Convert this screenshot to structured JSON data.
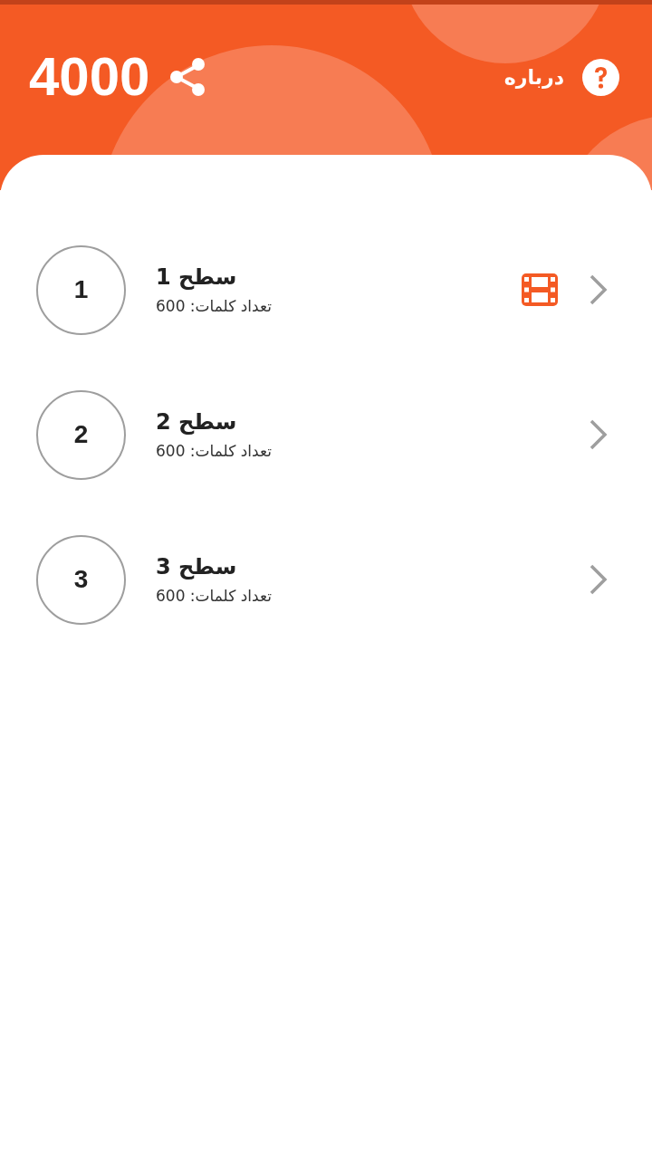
{
  "header": {
    "score": "4000",
    "about": "درباره"
  },
  "levels": [
    {
      "number": "1",
      "title": "سطح 1",
      "subtitle": "تعداد کلمات: 600",
      "video": true
    },
    {
      "number": "2",
      "title": "سطح 2",
      "subtitle": "تعداد کلمات: 600",
      "video": false
    },
    {
      "number": "3",
      "title": "سطح 3",
      "subtitle": "تعداد کلمات: 600",
      "video": false
    }
  ]
}
